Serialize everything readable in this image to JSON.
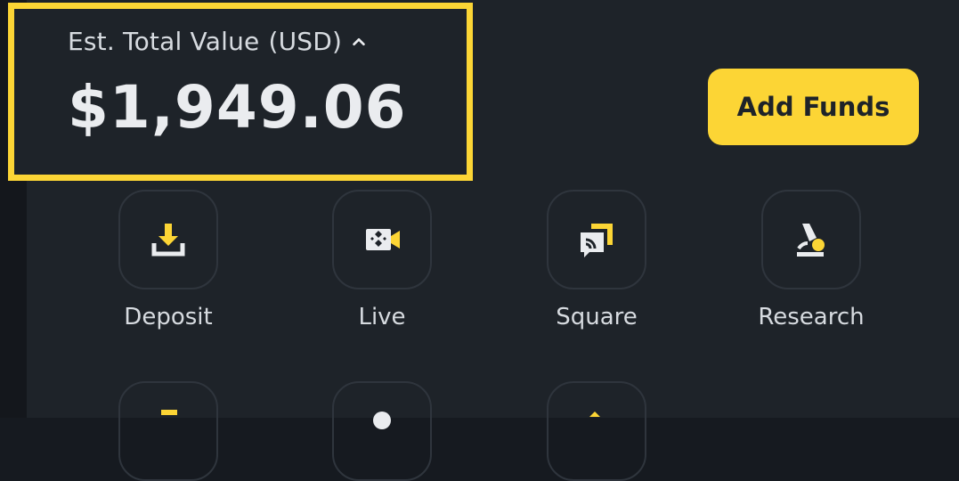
{
  "summary": {
    "label": "Est. Total Value",
    "currency": "(USD)",
    "amount": "$1,949.06"
  },
  "actions": {
    "add_funds_label": "Add Funds"
  },
  "shortcuts": [
    {
      "label": "Deposit",
      "icon": "deposit-icon"
    },
    {
      "label": "Live",
      "icon": "live-camera-icon"
    },
    {
      "label": "Square",
      "icon": "square-feed-icon"
    },
    {
      "label": "Research",
      "icon": "research-microscope-icon"
    }
  ],
  "colors": {
    "accent": "#fcd535",
    "background": "#1e2329",
    "text": "#eaecef",
    "tile_border": "#2f353d"
  }
}
